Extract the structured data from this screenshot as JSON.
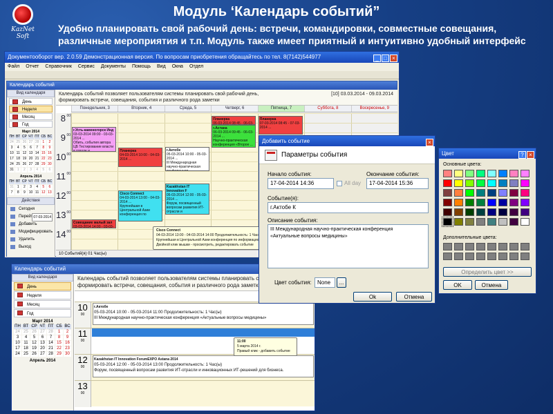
{
  "slide": {
    "title": "Модуль ‘Календарь событий”",
    "subtitle_line1": "Удобно планировать свой рабочий день: встречи, командировки, совместные совещания,",
    "subtitle_line2": "различные мероприятия и т.п. Модуль также имеет приятный и интуитивно удобный интерфейс",
    "logo_text_1": "KazNet",
    "logo_text_2": "Soft"
  },
  "main_window": {
    "title": "Документооборот вер. 2.0.59 Демонстрационная версия. По вопросам приобретения обращайтесь по тел. 8(7142)544977",
    "menu": [
      "Файл",
      "Отчет",
      "Справочник",
      "Сервис",
      "Документы",
      "Помощь",
      "Вид",
      "Окна",
      "Отдел"
    ],
    "mdi_title": "Календарь событий",
    "info_text_1": "Календарь событий позволяет пользователям системы планировать свой рабочий день,",
    "info_text_2": "формировать встречи, совещания, события и различного рода заметки",
    "range": "[10] 03.03.2014 - 09.03.2014",
    "days": [
      "Понедельник, 3",
      "Вторник, 4",
      "Среда, 5",
      "Четверг, 6",
      "Пятница, 7",
      "Суббота, 8",
      "Воскресенье, 9"
    ],
    "hours": [
      "8",
      "9",
      "10",
      "11",
      "12",
      "13",
      "14"
    ],
    "minutes": "00",
    "status": "10 Событий(я)    01 Час(ы)"
  },
  "left_panel": {
    "view_header": "Вид календаря",
    "views": [
      "День",
      "Неделя",
      "Месяц",
      "Год"
    ],
    "cal1_title": "Март 2014",
    "cal2_title": "Апрель 2014",
    "weekdays": [
      "ПН",
      "ВТ",
      "СР",
      "ЧТ",
      "ПТ",
      "СБ",
      "ВС"
    ],
    "march_days": [
      "24",
      "25",
      "26",
      "27",
      "28",
      "1",
      "2",
      "3",
      "4",
      "5",
      "6",
      "7",
      "8",
      "9",
      "10",
      "11",
      "12",
      "13",
      "14",
      "15",
      "16",
      "17",
      "18",
      "19",
      "20",
      "21",
      "22",
      "23",
      "24",
      "25",
      "26",
      "27",
      "28",
      "29",
      "30",
      "31",
      "1",
      "2",
      "3",
      "4",
      "5",
      "6"
    ],
    "april_days": [
      "31",
      "1",
      "2",
      "3",
      "4",
      "5",
      "6",
      "7",
      "8",
      "9",
      "10",
      "11",
      "12",
      "13"
    ],
    "actions_header": "Действия",
    "actions": [
      "Сегодня",
      "Перейти к дате",
      "Добавить",
      "Модифицировать",
      "Удалить",
      "Выход"
    ],
    "goto_date": "07-03-2014"
  },
  "events_top": [
    {
      "title": "г.Усть-каменогорск  Инд",
      "time": "03-03-2014 09:00 - 03-03-2014 ...",
      "body": "Обить, события автора ЦБ Тестирование власти в городе и",
      "color": "#f5a0f5"
    },
    {
      "title": "Планерка",
      "time": "04-03-2014 10:00 - 04-03-2014 ...",
      "body": "",
      "color": "#f04040"
    },
    {
      "title": "г.Актобе",
      "time": "05-03-2014 10:00 - 05-03-2014 ...",
      "body": "III Международная научно-практическая конференция «Актуальные",
      "color": "#ffffff"
    },
    {
      "title": "Планерка",
      "time": "06-03-2014 08:45 - 06-03-2014 ...",
      "body": "",
      "color": "#f04040"
    },
    {
      "title": "г.Астана",
      "time": "06-03-2014 09:45 - 06-03-2014 ...",
      "body": "Научно-практическая конференция «Второе ... 2014 в условиях данных»",
      "color": "#3ce03c"
    },
    {
      "title": "Планерка",
      "time": "07-03-2014 08:45 - 07-03-2014 ...",
      "body": "",
      "color": "#f04040"
    },
    {
      "title": "Kazakhstan IT Innovation F",
      "time": "05-03-2014 12:00 - 05-03-2014 ...",
      "body": "Форум, посвященный вопросам развития ИТ-отрасли и",
      "color": "#40e0f0"
    },
    {
      "title": "Cisco Connect",
      "time": "04-03-2014 13:00 - 04-03-2014 ...",
      "body": "Крупнейшая в Центральной Азии конференция по",
      "color": "#40e0f0"
    },
    {
      "title": "Совещание малый зал",
      "time": "03-03-2014 14:00 - 03-03-2014 ...",
      "body": "",
      "color": "#f04040"
    }
  ],
  "tooltip_top": {
    "title": "Cisco Connect",
    "line1": "04-03-2014 13:00 - 04-03-2014 14:00  Продолжительность: 1 Час(ы)",
    "line2": "Крупнейшая в Центральной Азии конференция по информационным ...",
    "line3": "Двойной клик мышки - просмотреть, редактировать событие"
  },
  "second_window": {
    "title": "Календарь событий",
    "info_text_1": "Календарь событий позволяет пользователям системы планировать свой рабочий день,",
    "info_text_2": "формировать встречи, совещания, события и различного рода заметки",
    "hours": [
      "10",
      "11",
      "12",
      "13"
    ],
    "events": [
      {
        "title": "г.Актобе",
        "line1": "05-03-2014 10:00 - 05-03-2014 11:00  Продолжительность: 1 Час(ы)",
        "line2": "III Международная научно-практическая конференция «Актуальные вопросы медицины»"
      },
      {
        "title": "Kazakhstan IT Innovation ForumEXPO Astana 2014",
        "line1": "05-03-2014 12:00 - 05-03-2014 13:00  Продолжительность: 1 Час(ы)",
        "line2": "Форум, посвященный вопросам развития ИТ-отрасли и инновационных ИТ-решений для бизнеса."
      }
    ],
    "tooltip": {
      "time": "11:00",
      "date": "5 марта 2014 г.",
      "hint": "Правый клик - добавить событие"
    },
    "march_title": "Март 2014",
    "april_title": "Апрель 2014"
  },
  "add_event_dialog": {
    "title": "Добавить событие",
    "header": "Параметры события",
    "start_label": "Начало события:",
    "start_value": "17-04-2014 14:36",
    "allday_label": "All day",
    "end_label": "Окончание события:",
    "end_value": "17-04-2014 15:36",
    "event_label": "Событие(я):",
    "event_value": "г.Актобе К",
    "desc_label": "Описание события:",
    "desc_value_1": "III Международная научно-практическая конференция",
    "desc_value_2": "«Актуальные вопросы медицины»",
    "color_label": "Цвет события:",
    "color_value": "None",
    "color_btn": "...",
    "ok": "Ok",
    "cancel": "Отмена"
  },
  "color_dialog": {
    "title": "Цвет",
    "basic_label": "Основные цвета:",
    "custom_label": "Дополнительные цвета:",
    "define_btn": "Определить цвет >>",
    "ok": "OK",
    "cancel": "Отмена",
    "help_btn": "?",
    "basic_colors": [
      "#ff8080",
      "#ffff80",
      "#80ff80",
      "#00ff80",
      "#80ffff",
      "#0080ff",
      "#ff80c0",
      "#ff80ff",
      "#ff0000",
      "#ffff00",
      "#80ff00",
      "#00ff40",
      "#00ffff",
      "#0080c0",
      "#8080c0",
      "#ff00ff",
      "#804040",
      "#ff8040",
      "#00ff00",
      "#008080",
      "#004080",
      "#8080ff",
      "#800040",
      "#ff0080",
      "#800000",
      "#ff8000",
      "#008000",
      "#008040",
      "#0000ff",
      "#0000a0",
      "#800080",
      "#8000ff",
      "#400000",
      "#804000",
      "#004000",
      "#004040",
      "#000080",
      "#000040",
      "#400040",
      "#400080",
      "#000000",
      "#808000",
      "#808040",
      "#808080",
      "#408080",
      "#c0c0c0",
      "#400040",
      "#ffffff"
    ],
    "custom_colors": [
      "#808080",
      "#808080",
      "#808080",
      "#808080",
      "#808080",
      "#808080",
      "#808080",
      "#808080",
      "#808080",
      "#808080",
      "#808080",
      "#808080",
      "#808080",
      "#808080",
      "#808080",
      "#808080"
    ]
  }
}
